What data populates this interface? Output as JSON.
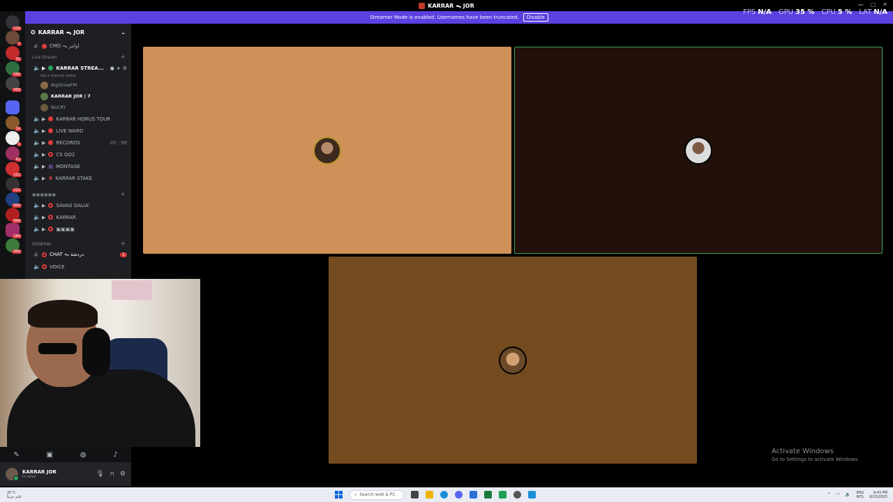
{
  "window": {
    "title": "KARRAR ᯓ JOR"
  },
  "banner": {
    "text": "Streamer Mode is enabled. Usernames have been truncated.",
    "button": "Disable"
  },
  "stats": [
    {
      "label": "FPS",
      "value": "N/A"
    },
    {
      "label": "GPU",
      "value": "35 %"
    },
    {
      "label": "CPU",
      "value": "5 %"
    },
    {
      "label": "LAT",
      "value": "N/A"
    }
  ],
  "guild_badges": [
    "120",
    "3",
    "33",
    "595",
    "493",
    "",
    "14",
    "1",
    "42",
    "122",
    "221",
    "906",
    "848",
    "164",
    "400"
  ],
  "server": {
    "name": "KARRAR ᯓ JOR"
  },
  "channels": {
    "cmd": "CMD ᯓ اوامر",
    "cat_live": "Live Stream",
    "live_channel": "KARRAR STREA...",
    "live_status": "Set a channel status",
    "members": [
      "BigShowFM",
      "KARRAR JOR | 7",
      "NoCRY"
    ],
    "voice": [
      "KARRAR HORUS TOUR",
      "LIVE WARD",
      "RECORDS",
      "CS GO2",
      "MONTAGE",
      "KARRAR STAKE"
    ],
    "records_badge": "00 : 99",
    "cat_2": "▣▣▣▣▣▣",
    "voice2": [
      "SAVAG DALIA'",
      "KARRAR",
      "▣▣▣▣"
    ],
    "cat_general": "GENERAL",
    "chat": "CHAT ᯓ دردشة",
    "chat_badge": "1",
    "voice_peek": "VOICE"
  },
  "user": {
    "name": "KARRAR JOR",
    "status": "In voice"
  },
  "activate": {
    "title": "Activate Windows",
    "subtitle": "Go to Settings to activate Windows."
  },
  "taskbar": {
    "weather_temp": "31°C",
    "weather_desc": "غائم جزئياً",
    "search_placeholder": "Search web & PC",
    "lang": "ENG",
    "lang2": "INTL",
    "time": "9:43 PM",
    "date": "8/15/2025"
  },
  "colors": {
    "accent": "#5c40e0",
    "tile1": "#cf9158",
    "tile2": "#21110a",
    "tile3": "#744b1f",
    "speaking_border": "#3ba55c"
  }
}
